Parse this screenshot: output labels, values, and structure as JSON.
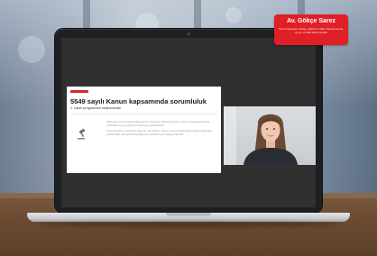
{
  "badge": {
    "name": "Av. Gökçe Sarez",
    "description": "Sanı Anayasası Uzlaşıy, Ekibiniz Hakkı Danışmanıyla, Uyum ve Etki Sahip kredisi"
  },
  "slide": {
    "title": "5549 sayılı Kanun kapsamında sorumluluk",
    "subtitle": "1. Uyum programının oluşturulması",
    "body": [
      "5549 sayılı Suç Gelirlerinin Aklanmasının Önlenmesi Hakkında Kanun ve ilgili mevzuat kapsamında yükümlülerin uyum programı oluşturması gerekmektedir.",
      "Uyum görevlisi ve yardımcısı atanmalı, risk yönetimi, izleme ve kontrol faaliyetleri ile eğitim çalışmaları yürütülmelidir. Bu kapsamda politika ve prosedürler yazılı hale getirilmelidir."
    ],
    "icon": "gavel-icon"
  },
  "video": {
    "icon": "presenter-video"
  },
  "colors": {
    "accent": "#e01f26",
    "slide_accent": "#d62a28",
    "screen": "#303030"
  }
}
